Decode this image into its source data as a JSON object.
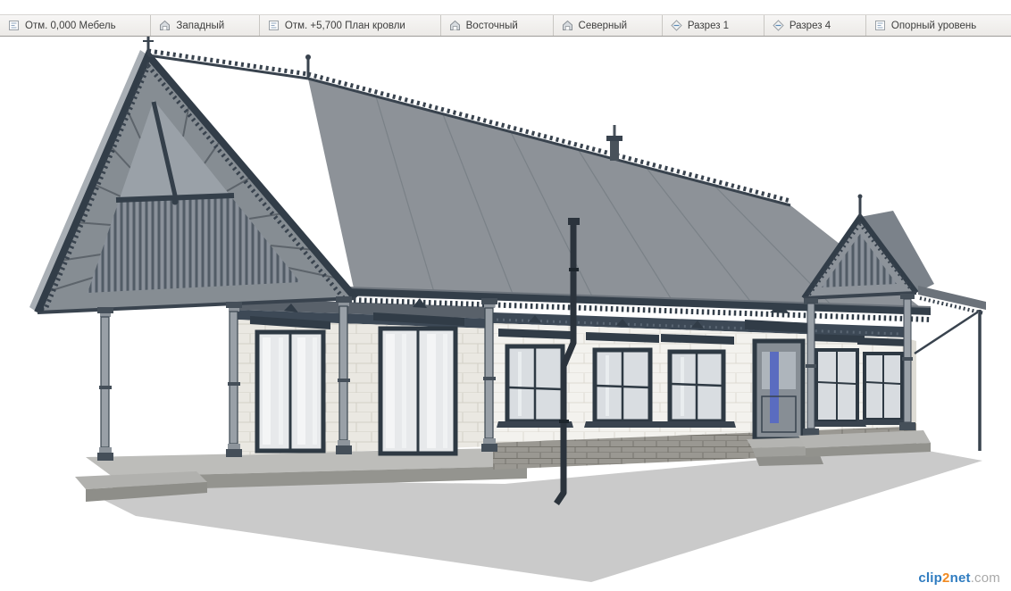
{
  "tab_bar": {
    "tabs": [
      {
        "label": "Отм. 0,000 Мебель",
        "type": "plan",
        "icon": "floor-plan-icon"
      },
      {
        "label": "Западный",
        "type": "elevation",
        "icon": "elevation-icon"
      },
      {
        "label": "Отм. +5,700 План кровли",
        "type": "plan",
        "icon": "floor-plan-icon"
      },
      {
        "label": "Восточный",
        "type": "elevation",
        "icon": "elevation-icon"
      },
      {
        "label": "Северный",
        "type": "elevation",
        "icon": "elevation-icon"
      },
      {
        "label": "Разрез 1",
        "type": "section",
        "icon": "section-icon"
      },
      {
        "label": "Разрез 4",
        "type": "section",
        "icon": "section-icon"
      },
      {
        "label": "Опорный уровень",
        "type": "plan",
        "icon": "floor-plan-icon"
      }
    ]
  },
  "viewport": {
    "content": "3D shaded view of a single-storey timber house with ornate carved trim: grey gable roofs with crest ornaments, white stone-block walls, slate-blue window surrounds, open veranda on columns at the left and an entrance porch with small gable at the right, downspout in the middle"
  },
  "watermark": {
    "part1": "clip",
    "part2": "2",
    "part3": "net",
    "part4": ".com"
  },
  "colors": {
    "trim_dark": "#3b4854",
    "roof_gray": "#8d9298",
    "wall_white": "#f3f2ee",
    "foundation_gray": "#9a9892",
    "door_glazing_blue": "#5a6cc0",
    "tab_text": "#3e3e3e",
    "watermark_blue": "#2f7cc0",
    "watermark_orange": "#f18a21"
  }
}
